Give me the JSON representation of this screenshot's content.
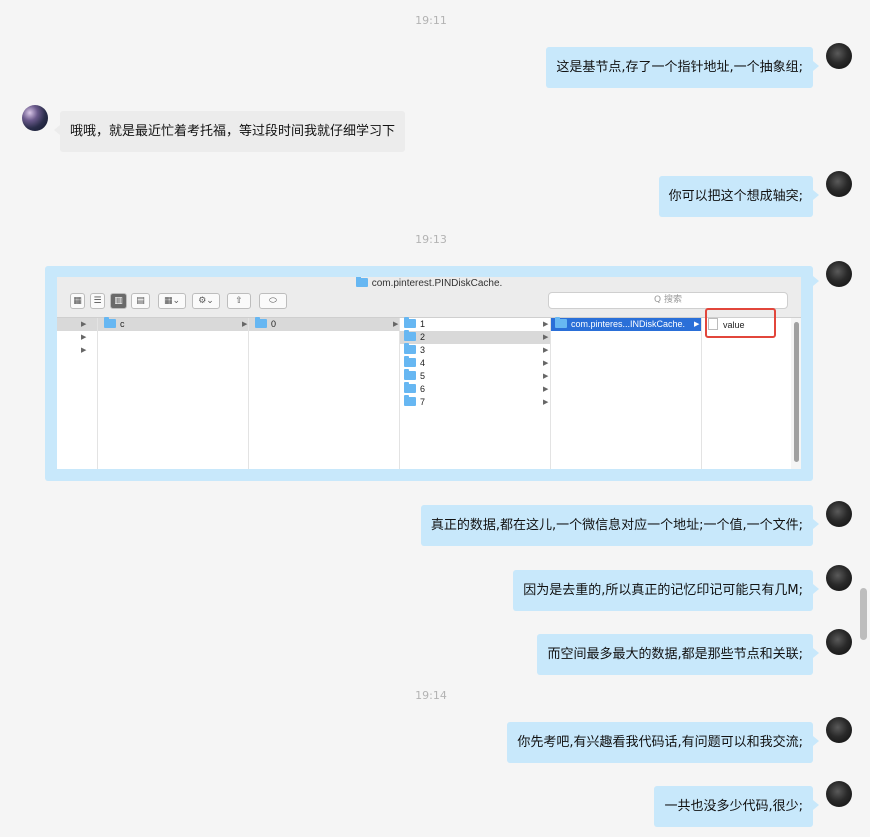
{
  "timestamps": [
    "19:11",
    "19:13",
    "19:14"
  ],
  "messages": [
    {
      "from": "me",
      "text": "这是基节点,存了一个指针地址,一个抽象组;"
    },
    {
      "from": "other",
      "text": "哦哦，就是最近忙着考托福，等过段时间我就仔细学习下"
    },
    {
      "from": "me",
      "text": "你可以把这个想成轴突;"
    },
    {
      "from": "me",
      "text": "真正的数据,都在这儿,一个微信息对应一个地址;一个值,一个文件;"
    },
    {
      "from": "me",
      "text": "因为是去重的,所以真正的记忆印记可能只有几M;"
    },
    {
      "from": "me",
      "text": "而空间最多最大的数据,都是那些节点和关联;"
    },
    {
      "from": "me",
      "text": "你先考吧,有兴趣看我代码话,有问题可以和我交流;"
    },
    {
      "from": "me",
      "text": "一共也没多少代码,很少;"
    }
  ],
  "finder": {
    "title": "com.pinterest.PINDiskCache.",
    "search_placeholder": "Q 搜索",
    "col1_items": [
      "c"
    ],
    "col2_items": [
      "0"
    ],
    "col3_items": [
      "1",
      "2",
      "3",
      "4",
      "5",
      "6",
      "7"
    ],
    "col4_items": [
      "com.pinteres...INDiskCache."
    ],
    "col5_items": [
      "value"
    ]
  },
  "colors": {
    "my_bubble": "#c8e8fb",
    "other_bubble": "#ececec",
    "highlight": "#e2463b",
    "selection": "#2a6fd8"
  }
}
